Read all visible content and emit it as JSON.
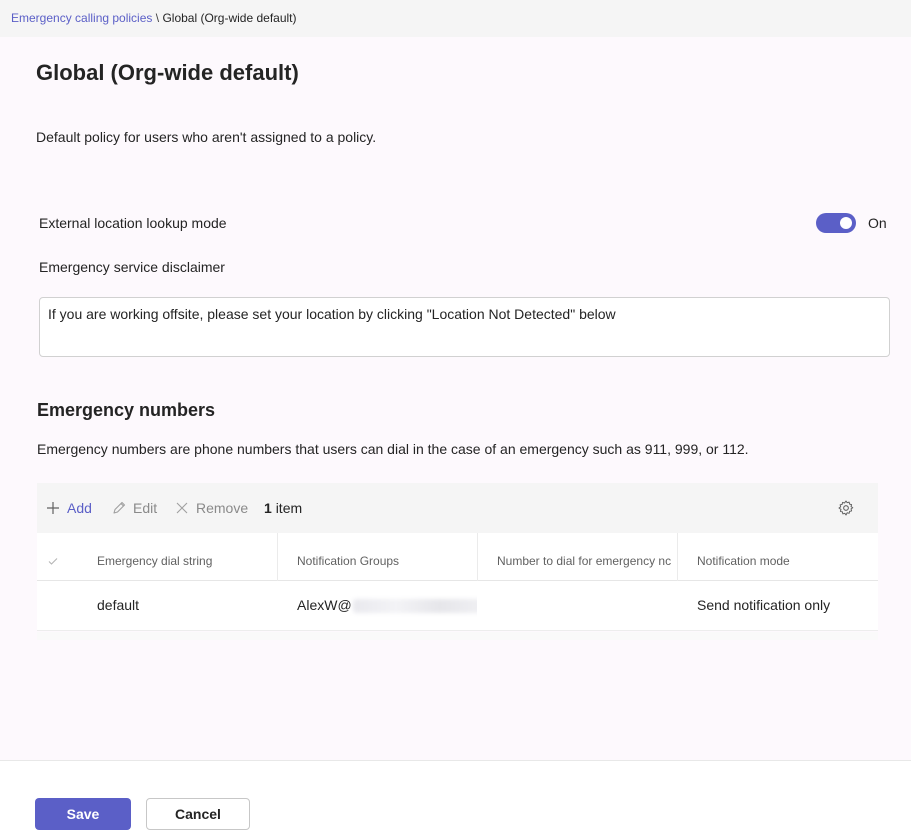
{
  "breadcrumb": {
    "parent": "Emergency calling policies",
    "separator": "\\",
    "current": "Global (Org-wide default)"
  },
  "page": {
    "title": "Global (Org-wide default)",
    "description": "Default policy for users who aren't assigned to a policy."
  },
  "settings": {
    "external_lookup_label": "External location lookup mode",
    "external_lookup_state": "On",
    "disclaimer_label": "Emergency service disclaimer",
    "disclaimer_value": "If you are working offsite, please set your location by clicking \"Location Not Detected\" below"
  },
  "emergency_numbers": {
    "title": "Emergency numbers",
    "description": "Emergency numbers are phone numbers that users can dial in the case of an emergency such as 911, 999, or 112.",
    "toolbar": {
      "add": "Add",
      "edit": "Edit",
      "remove": "Remove",
      "count_number": "1",
      "count_label": "item"
    },
    "columns": [
      "Emergency dial string",
      "Notification Groups",
      "Number to dial for emergency nc",
      "Notification mode"
    ],
    "rows": [
      {
        "dial_string": "default",
        "notification_group_prefix": "AlexW@",
        "number_to_dial": "",
        "notification_mode": "Send notification only"
      }
    ]
  },
  "footer": {
    "save": "Save",
    "cancel": "Cancel"
  },
  "colors": {
    "accent": "#5b5fc7",
    "background": "#fdf9fd"
  },
  "icons": [
    "plus-icon",
    "pencil-icon",
    "close-icon",
    "gear-icon",
    "checkmark-icon"
  ]
}
